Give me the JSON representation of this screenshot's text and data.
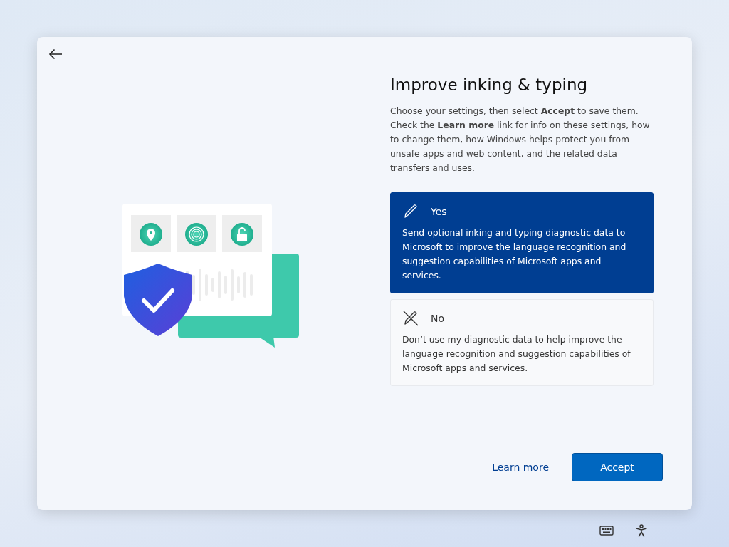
{
  "title": "Improve inking & typing",
  "description": "Choose your settings, then select **Accept** to save them. Check the **Learn more** link for info on these settings, how to change them, how Windows helps protect you from unsafe apps and web content, and the related data transfers and uses.",
  "options": [
    {
      "kind": "pen",
      "label": "Yes",
      "text": "Send optional inking and typing diagnostic data to Microsoft to improve the language recognition and suggestion capabilities of Microsoft apps and services.",
      "selected": true
    },
    {
      "kind": "pen-crossed",
      "label": "No",
      "text": "Don’t use my diagnostic data to help improve the language recognition and suggestion capabilities of Microsoft apps and services.",
      "selected": false
    }
  ],
  "buttons": {
    "link": "Learn more",
    "primary": "Accept"
  }
}
